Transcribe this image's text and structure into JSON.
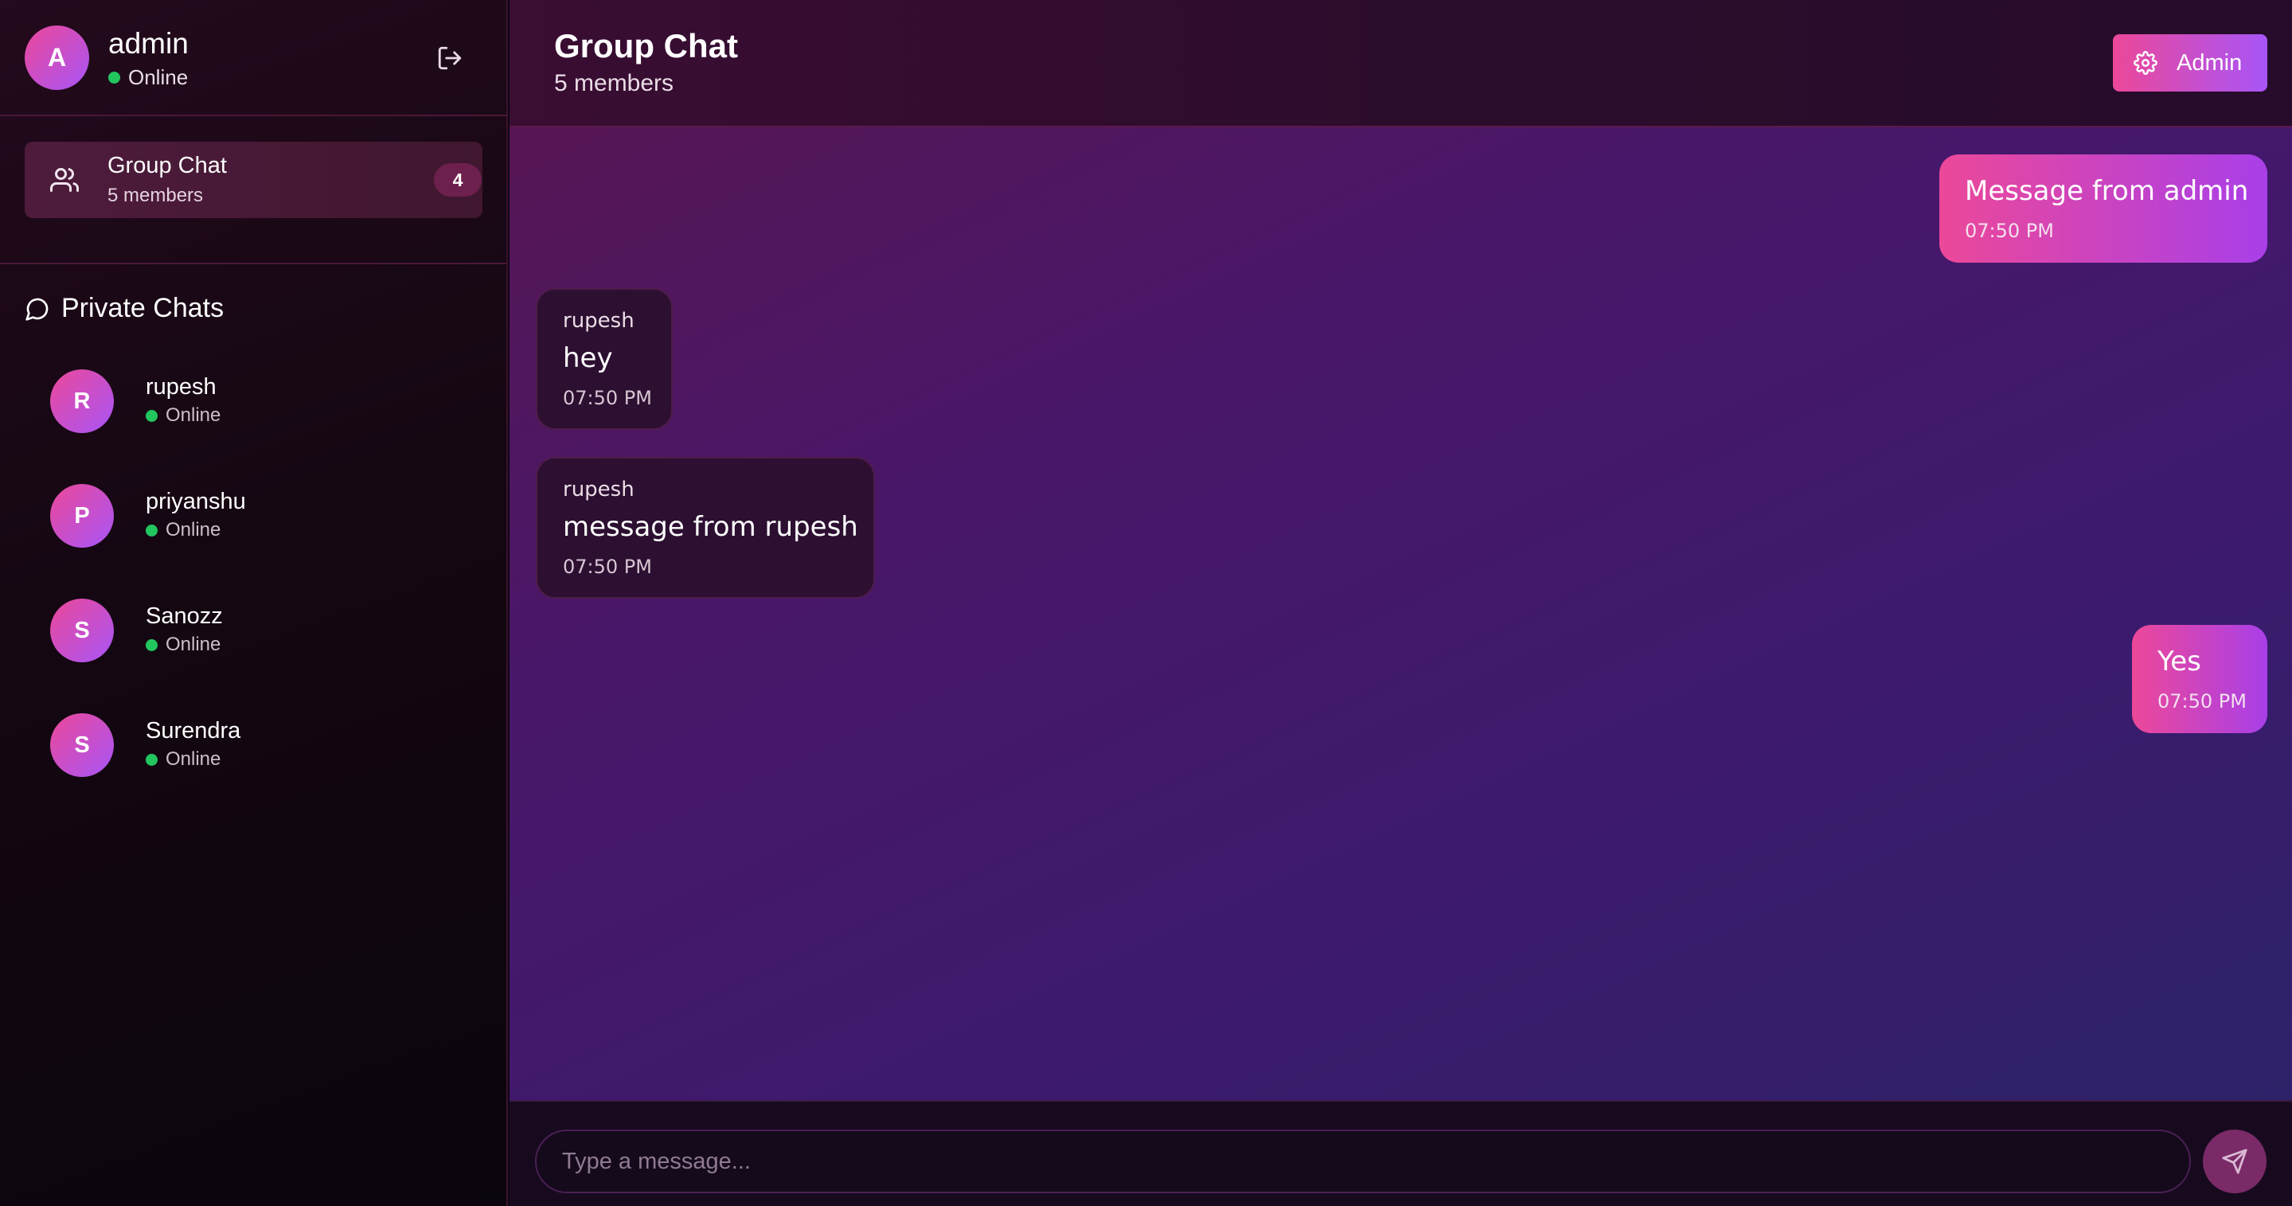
{
  "me": {
    "initial": "A",
    "name": "admin",
    "status": "Online"
  },
  "group": {
    "title": "Group Chat",
    "members": "5 members",
    "unread": "4"
  },
  "private": {
    "title": "Private Chats",
    "contacts": [
      {
        "initial": "R",
        "name": "rupesh",
        "status": "Online"
      },
      {
        "initial": "P",
        "name": "priyanshu",
        "status": "Online"
      },
      {
        "initial": "S",
        "name": "Sanozz",
        "status": "Online"
      },
      {
        "initial": "S",
        "name": "Surendra",
        "status": "Online"
      }
    ]
  },
  "header": {
    "title": "Group Chat",
    "subtitle": "5 members",
    "admin_label": "Admin"
  },
  "messages": [
    {
      "direction": "out",
      "text": "Message from admin",
      "time": "07:50 PM"
    },
    {
      "direction": "in",
      "sender": "rupesh",
      "text": "hey",
      "time": "07:50 PM"
    },
    {
      "direction": "in",
      "sender": "rupesh",
      "text": "message from rupesh",
      "time": "07:50 PM"
    },
    {
      "direction": "out",
      "text": "Yes",
      "time": "07:50 PM"
    }
  ],
  "composer": {
    "placeholder": "Type a message..."
  },
  "colors": {
    "accent_start": "#ec4899",
    "accent_end": "#a855f7",
    "online": "#22c55e",
    "incoming_bubble": "#2c0f31"
  },
  "icons": {
    "logout": "logout-icon",
    "group": "users-icon",
    "private": "chat-bubble-icon",
    "settings": "gear-icon",
    "send": "send-icon"
  }
}
